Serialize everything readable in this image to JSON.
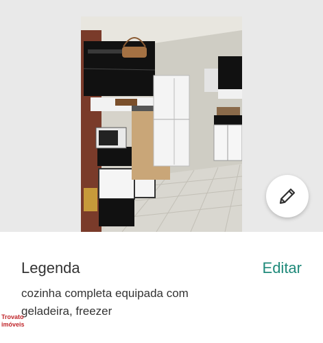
{
  "photo": {
    "subject": "kitchen-photo"
  },
  "edit_button": {
    "icon": "pencil-icon"
  },
  "caption": {
    "title": "Legenda",
    "edit_label": "Editar",
    "text": "cozinha completa equipada com geladeira, freezer"
  },
  "watermark": {
    "line1": "Trovato",
    "line2": "imóveis"
  },
  "colors": {
    "accent": "#1f8a7a",
    "text": "#333333",
    "photo_backdrop": "#e9e9e9",
    "watermark": "#c0262b"
  }
}
